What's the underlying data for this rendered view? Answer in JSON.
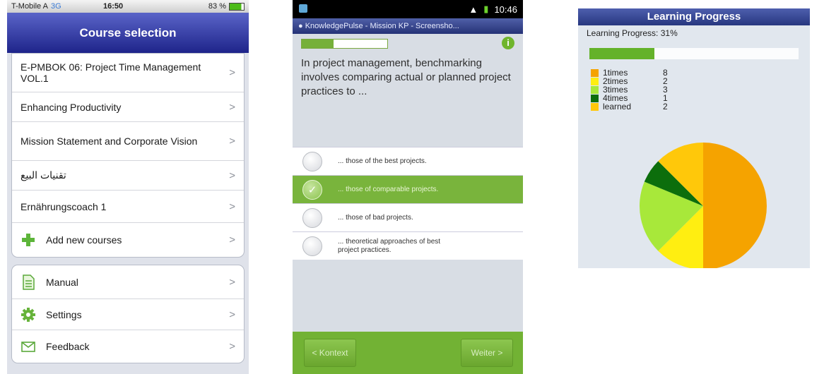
{
  "panel_ios": {
    "status": {
      "carrier": "T-Mobile A",
      "network": "3G",
      "time": "16:50",
      "battery": "83 %"
    },
    "nav_title": "Course selection",
    "courses": [
      {
        "label": "E-PMBOK 06: Project Time Management VOL.1"
      },
      {
        "label": "Enhancing Productivity"
      },
      {
        "label": "Mission Statement and Corporate Vision"
      },
      {
        "label": "تقنيات البيع"
      },
      {
        "label": "Ernährungscoach 1"
      },
      {
        "label": "Add new courses",
        "icon": "plus-icon"
      }
    ],
    "menu": [
      {
        "label": "Manual",
        "icon": "document-icon"
      },
      {
        "label": "Settings",
        "icon": "gear-icon"
      },
      {
        "label": "Feedback",
        "icon": "envelope-icon"
      }
    ],
    "chevron": ">"
  },
  "panel_quiz": {
    "status": {
      "time": "10:46"
    },
    "app_title": "KnowledgePulse - Mission KP - Screensho...",
    "progress": 0.37,
    "info": "i",
    "question": "In project management, benchmarking involves comparing actual or planned project practices to ...",
    "answers": [
      {
        "text": "... those of the best projects.",
        "selected": false
      },
      {
        "text": "... those of comparable projects.",
        "selected": true
      },
      {
        "text": "... those of bad projects.",
        "selected": false
      },
      {
        "text": "... theoretical approaches of best project practices.",
        "selected": false
      }
    ],
    "back_label": "< Kontext",
    "next_label": "Weiter >",
    "accent": "#76b03a"
  },
  "panel_progress": {
    "title": "Learning Progress",
    "progress_label": "Learning Progress: 31%",
    "progress": 0.31,
    "chart_data": {
      "type": "pie",
      "legend_position": "top-left",
      "categories": [
        "1times",
        "2times",
        "3times",
        "4times",
        "learned"
      ],
      "values": [
        8,
        2,
        3,
        1,
        2
      ],
      "colors": [
        "#f5a300",
        "#ffee11",
        "#a8e83a",
        "#0c6e0c",
        "#ffc80a"
      ]
    }
  }
}
